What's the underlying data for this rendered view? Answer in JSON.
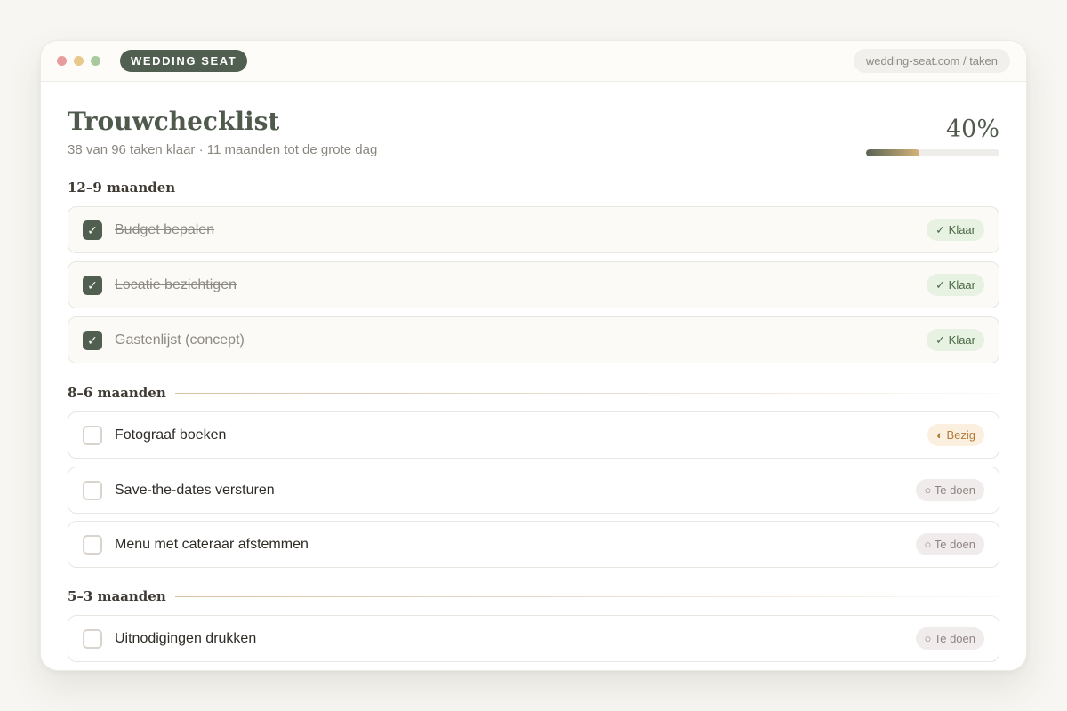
{
  "window": {
    "brand": "WEDDING SEAT",
    "url": "wedding-seat.com / taken"
  },
  "page": {
    "title": "Trouwchecklist",
    "subtitle": "38 van 96 taken klaar · 11 maanden tot de grote dag",
    "progress_label": "40%",
    "progress_fraction": 0.4
  },
  "sections": [
    {
      "title": "12–9 maanden",
      "tasks": [
        {
          "label": "Budget bepalen",
          "status": "✓ Klaar",
          "done": true
        },
        {
          "label": "Locatie bezichtigen",
          "status": "✓ Klaar",
          "done": true
        },
        {
          "label": "Gastenlijst (concept)",
          "status": "✓ Klaar",
          "done": true
        }
      ]
    },
    {
      "title": "8–6 maanden",
      "tasks": [
        {
          "label": "Fotograaf boeken",
          "status": "◐ Bezig",
          "done": false
        },
        {
          "label": "Save-the-dates versturen",
          "status": "○ Te doen",
          "done": false
        },
        {
          "label": "Menu met cateraar afstemmen",
          "status": "○ Te doen",
          "done": false
        }
      ]
    },
    {
      "title": "5–3 maanden",
      "tasks": [
        {
          "label": "Uitnodigingen drukken",
          "status": "○ Te doen",
          "done": false
        }
      ]
    }
  ],
  "icons": {
    "checkbox_checked": "checkmark-icon"
  },
  "colors": {
    "brand": "#515f50",
    "accent_gold": "#d3b479",
    "done_badge": "#e7f2e2",
    "in_progress_badge": "#fbefdf",
    "todo_badge": "#f1ecec"
  }
}
